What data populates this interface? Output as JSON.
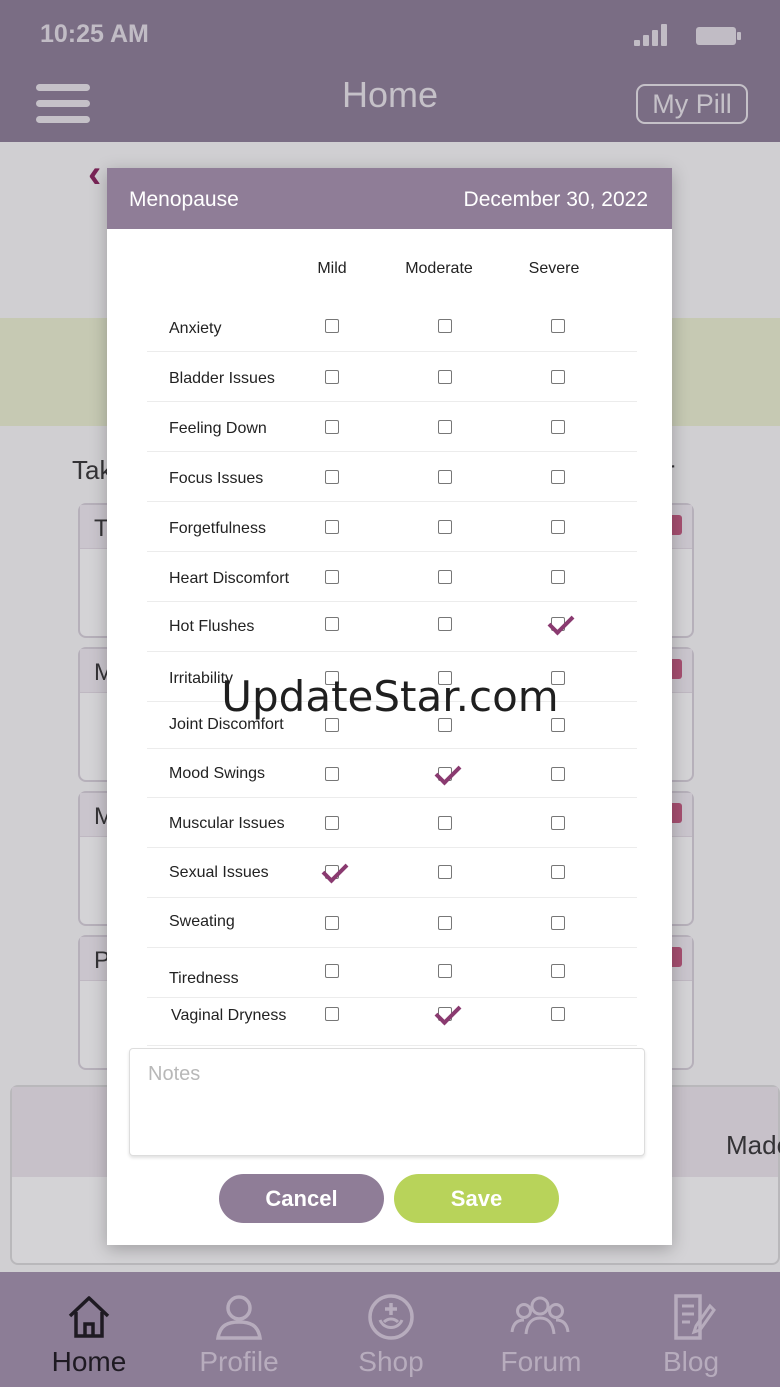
{
  "status_bar": {
    "time": "10:25 AM"
  },
  "app_bar": {
    "title": "Home",
    "my_pill_label": "My Pill"
  },
  "background": {
    "take_text": "Tak",
    "right_text": "r",
    "card_letters": [
      "T",
      "M",
      "M",
      "P"
    ],
    "made_text": "Made"
  },
  "modal": {
    "category": "Menopause",
    "date": "December 30, 2022",
    "columns": [
      "Mild",
      "Moderate",
      "Severe"
    ],
    "rows": [
      {
        "symptom": "Anxiety",
        "selected": "none"
      },
      {
        "symptom": "Bladder Issues",
        "selected": "none"
      },
      {
        "symptom": "Feeling Down",
        "selected": "none"
      },
      {
        "symptom": "Focus Issues",
        "selected": "none"
      },
      {
        "symptom": "Forgetfulness",
        "selected": "none"
      },
      {
        "symptom": "Heart Discomfort",
        "selected": "none"
      },
      {
        "symptom": "Hot Flushes",
        "selected": "Severe"
      },
      {
        "symptom": "Irritability",
        "selected": "none"
      },
      {
        "symptom": "Joint Discomfort",
        "selected": "none"
      },
      {
        "symptom": "Mood Swings",
        "selected": "Moderate"
      },
      {
        "symptom": "Muscular Issues",
        "selected": "none"
      },
      {
        "symptom": "Sexual Issues",
        "selected": "Mild"
      },
      {
        "symptom": "Sweating",
        "selected": "none"
      },
      {
        "symptom": "Tiredness",
        "selected": "none"
      },
      {
        "symptom": "Vaginal Dryness",
        "selected": "Moderate"
      }
    ],
    "notes_placeholder": "Notes",
    "notes_value": "",
    "cancel_label": "Cancel",
    "save_label": "Save"
  },
  "bottom_nav": {
    "items": [
      {
        "label": "Home",
        "icon": "home-icon",
        "active": true
      },
      {
        "label": "Profile",
        "icon": "profile-icon",
        "active": false
      },
      {
        "label": "Shop",
        "icon": "shop-icon",
        "active": false
      },
      {
        "label": "Forum",
        "icon": "forum-icon",
        "active": false
      },
      {
        "label": "Blog",
        "icon": "blog-icon",
        "active": false
      }
    ]
  },
  "watermark": "UpdateStar.com",
  "colors": {
    "header_purple": "#8f7d97",
    "check_mark": "#8a3a70",
    "save_green": "#b8d35a",
    "accent_magenta": "#8a1f5c"
  }
}
